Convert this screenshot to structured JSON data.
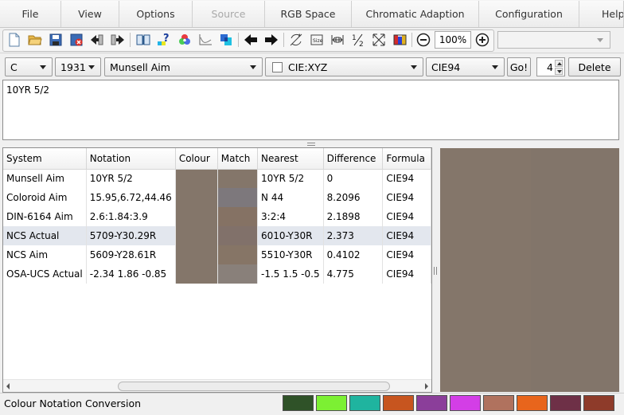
{
  "menu": {
    "items": [
      {
        "label": "File",
        "disabled": false
      },
      {
        "label": "View",
        "disabled": false
      },
      {
        "label": "Options",
        "disabled": false
      },
      {
        "label": "Source",
        "disabled": true
      },
      {
        "label": "RGB Space",
        "disabled": false
      },
      {
        "label": "Chromatic Adaption",
        "disabled": false
      },
      {
        "label": "Configuration",
        "disabled": false
      },
      {
        "label": "Help",
        "disabled": false
      }
    ]
  },
  "toolbar": {
    "icons": [
      "new-icon",
      "open-folder-icon",
      "save-icon",
      "delete-file-icon",
      "import-icon",
      "export-icon",
      "book-icon",
      "help-icon",
      "color-wheel-icon",
      "graph-icon",
      "swatch-icon",
      "back-arrow-icon",
      "forward-arrow-icon",
      "refresh-icon",
      "size-icon",
      "fit-width-icon",
      "half-icon",
      "fullscreen-icon",
      "palette-icon",
      "zoom-out-icon",
      "zoom-in-icon"
    ],
    "zoom": "100%",
    "combo_value": ""
  },
  "options": {
    "illuminant": "C",
    "observer": "1931",
    "source_system": "Munsell Aim",
    "target_checked": false,
    "target_system": "CIE:XYZ",
    "formula": "CIE94",
    "go_label": "Go!",
    "count": "4",
    "delete_label": "Delete"
  },
  "input": {
    "text": "10YR 5/2"
  },
  "table": {
    "headers": [
      "System",
      "Notation",
      "Colour",
      "Match",
      "Nearest",
      "Difference",
      "Formula"
    ],
    "rows": [
      {
        "system": "Munsell Aim",
        "notation": "10YR 5/2",
        "colour": "#84766a",
        "match": "#84766a",
        "nearest": "10YR 5/2",
        "difference": "0",
        "formula": "CIE94",
        "selected": false
      },
      {
        "system": "Coloroid Aim",
        "notation": "15.95,6.72,44.46",
        "colour": "#84766a",
        "match": "#7d787c",
        "nearest": "N 44",
        "difference": "8.2096",
        "formula": "CIE94",
        "selected": false
      },
      {
        "system": "DIN-6164 Aim",
        "notation": "2.6:1.84:3.9",
        "colour": "#84766a",
        "match": "#857264",
        "nearest": "3:2:4",
        "difference": "2.1898",
        "formula": "CIE94",
        "selected": false
      },
      {
        "system": "NCS Actual",
        "notation": "5709-Y30.29R",
        "colour": "#84766a",
        "match": "#81716a",
        "nearest": "6010-Y30R",
        "difference": "2.373",
        "formula": "CIE94",
        "selected": true
      },
      {
        "system": "NCS Aim",
        "notation": "5609-Y28.61R",
        "colour": "#84766a",
        "match": "#867566",
        "nearest": "5510-Y30R",
        "difference": "0.4102",
        "formula": "CIE94",
        "selected": false
      },
      {
        "system": "OSA-UCS Actual",
        "notation": "-2.34 1.86 -0.85",
        "colour": "#84766a",
        "match": "#89807a",
        "nearest": "-1.5 1.5 -0.5",
        "difference": "4.775",
        "formula": "CIE94",
        "selected": false
      }
    ]
  },
  "preview": {
    "left_color": "#84766a",
    "right_color": "#82756a"
  },
  "status": {
    "text": "Colour Notation Conversion",
    "palette": [
      "#2f5228",
      "#7cf033",
      "#1fb49f",
      "#c7551f",
      "#8b3e9a",
      "#d33ee6",
      "#b0725e",
      "#e8651c",
      "#6e3047",
      "#8e3b2a"
    ]
  }
}
